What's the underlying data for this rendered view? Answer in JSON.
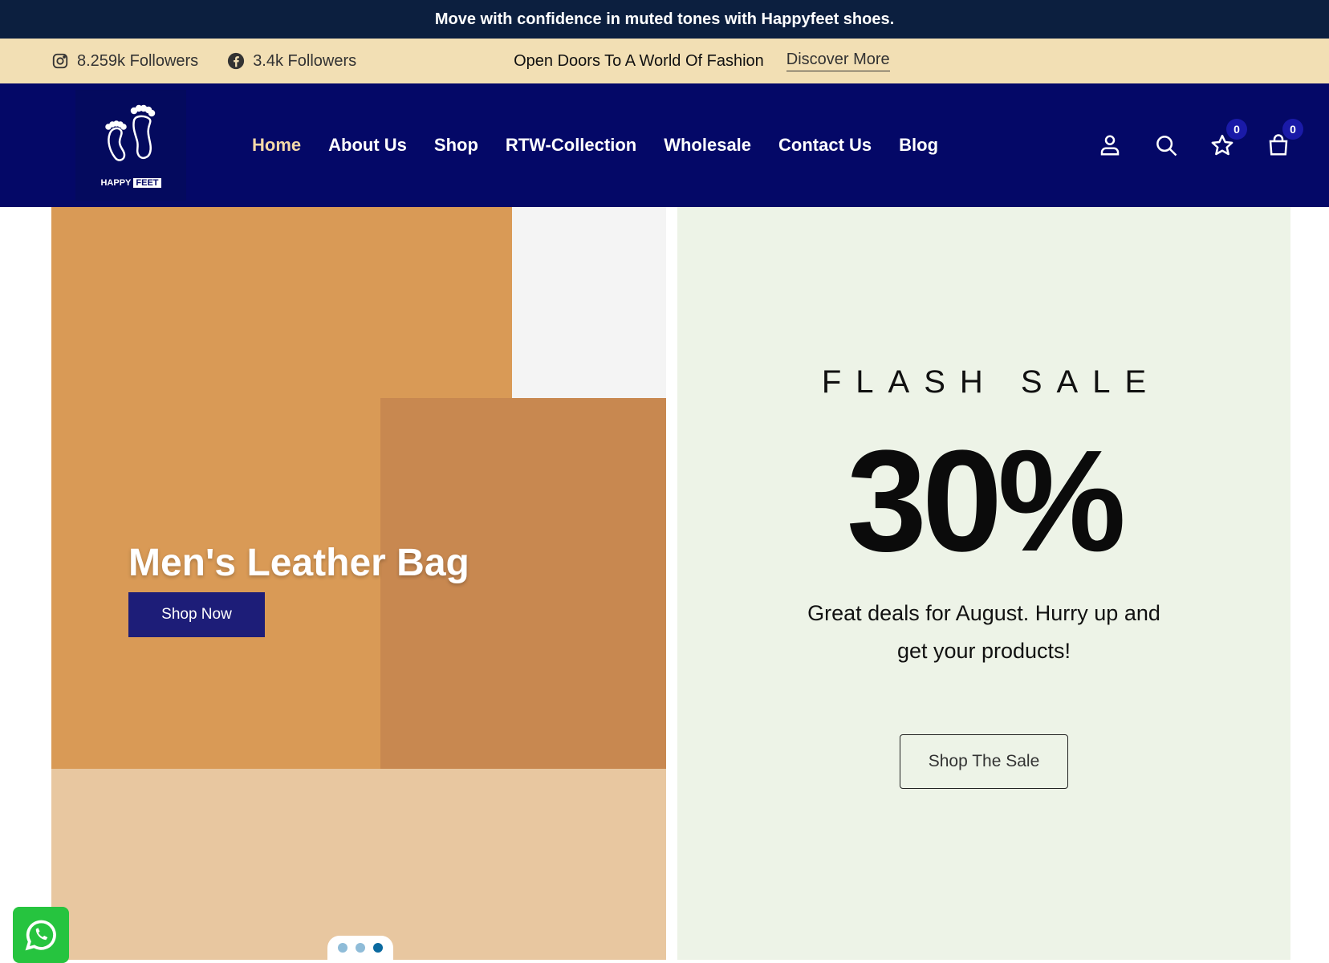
{
  "announcement": {
    "text": "Move with confidence in muted tones with Happyfeet shoes."
  },
  "topbar": {
    "instagram": {
      "icon": "instagram-icon",
      "followers": "8.259k Followers"
    },
    "facebook": {
      "icon": "facebook-icon",
      "followers": "3.4k Followers"
    },
    "promo_text": "Open Doors To A World Of Fashion",
    "discover_label": "Discover More"
  },
  "header": {
    "logo": {
      "word1": "HAPPY",
      "word2": "FEET"
    },
    "nav": [
      {
        "label": "Home",
        "active": true
      },
      {
        "label": "About Us"
      },
      {
        "label": "Shop"
      },
      {
        "label": "RTW-Collection"
      },
      {
        "label": "Wholesale"
      },
      {
        "label": "Contact Us"
      },
      {
        "label": "Blog"
      }
    ],
    "icons": {
      "account": "user-icon",
      "search": "search-icon",
      "wishlist": {
        "icon": "star-icon",
        "count": "0"
      },
      "cart": {
        "icon": "shopping-bag-icon",
        "count": "0"
      }
    }
  },
  "hero": {
    "title": "Men's Leather Bag",
    "button_label": "Shop Now",
    "slides": 3,
    "active_slide": 3
  },
  "sale": {
    "title": "FLASH SALE",
    "percent": "30%",
    "description": "Great deals for August. Hurry up and get your products!",
    "button_label": "Shop The Sale"
  },
  "colors": {
    "announcement_bg": "#0c1f3f",
    "topbar_bg": "#f2dfb4",
    "header_bg": "#040867",
    "nav_active": "#f5d9a8",
    "sale_bg": "#edf3e7",
    "whatsapp": "#26c43f"
  }
}
